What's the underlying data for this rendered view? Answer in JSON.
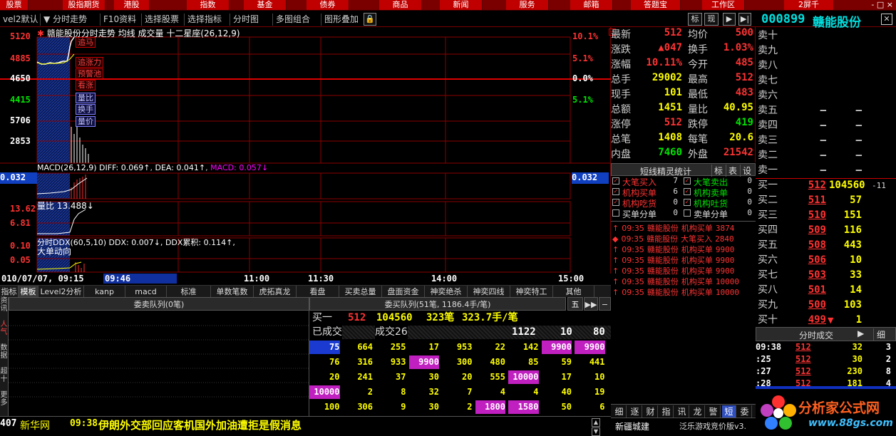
{
  "top_menu": [
    "股票",
    "股指期货",
    "港股",
    "指数",
    "基金",
    "债券",
    "商品",
    "新闻",
    "服务",
    "邮箱",
    "答题宝",
    "工作区",
    "2屏千"
  ],
  "window_controls": "- □ ×",
  "toolbar": {
    "items": [
      "vel2默认",
      "分时走势",
      "F10资料",
      "选择股票",
      "选择指标",
      "分时图",
      "多图组合",
      "图形叠加"
    ],
    "right_btns": [
      "标",
      "现",
      "▶",
      "▶|"
    ]
  },
  "chart": {
    "title": "赣能股份分时走势",
    "title_suffix": "均线  成交量  十二星座(26,12,9)",
    "price_labels": [
      "5120",
      "4885",
      "4650",
      "4415",
      "5706",
      "2853"
    ],
    "pct_labels": [
      "10.1%",
      "5.1%",
      "0.0%",
      "5.1%"
    ],
    "annotations": [
      "追马",
      "追涨力",
      "预警池",
      "看涨",
      "量比",
      "换手",
      "量价"
    ],
    "macd_title": "MACD(26,12,9)",
    "macd_diff": "DIFF: 0.069↑",
    "macd_dea": "DEA: 0.041↑",
    "macd_val": "MACD: 0.057↓",
    "macd_left": "0.032",
    "macd_right": "0.032",
    "vr_title": "量比 13.488↓",
    "vr_labels": [
      "13.62",
      "6.81"
    ],
    "ddx_title": "分时DDX(60,5,10)",
    "ddx_val": "DDX: 0.007↓,",
    "ddx_sum": "DDX累积: 0.114↑,",
    "ddx_sub": "大单动向",
    "ddx_labels": [
      "0.10",
      "0.05"
    ]
  },
  "time_axis": {
    "date": "010/07/07, 09:15",
    "cursor": "09:46",
    "ticks": [
      "11:00",
      "11:30",
      "14:00",
      "15:00"
    ]
  },
  "tabs": [
    "指标",
    "模板",
    "Level2分析",
    "kanp",
    "macd",
    "标准",
    "单数笔数",
    "虎拓真龙",
    "看盘",
    "买卖总量",
    "盘面资金",
    "神奕绝杀",
    "神奕四线",
    "神奕特工",
    "其他"
  ],
  "left_side_tabs": [
    "资讯",
    "人气",
    "数据",
    "超十",
    "更多"
  ],
  "commission_queue": {
    "title": "委卖队列(0笔)"
  },
  "buy_queue": {
    "title": "委买队列(51笔, 1186.4手/笔)",
    "btn": "五",
    "row1": [
      "买一",
      "512",
      "104560",
      "323笔",
      "323.7手/笔"
    ],
    "row2": [
      "已成交",
      "成交26",
      "1122",
      "10",
      "80"
    ],
    "grid": [
      [
        "75",
        "664",
        "255",
        "17",
        "953",
        "22",
        "142",
        "9900",
        "9900"
      ],
      [
        "76",
        "316",
        "933",
        "9900",
        "300",
        "480",
        "85",
        "59",
        "441"
      ],
      [
        "20",
        "241",
        "37",
        "30",
        "20",
        "555",
        "10000",
        "17",
        "10"
      ],
      [
        "10000",
        "2",
        "8",
        "32",
        "7",
        "4",
        "4",
        "40",
        "19"
      ],
      [
        "100",
        "306",
        "9",
        "30",
        "2",
        "1800",
        "1580",
        "50",
        "6"
      ]
    ]
  },
  "quote": {
    "code": "000899",
    "name": "赣能股份",
    "rows": [
      [
        "最新",
        "512",
        "均价",
        "500"
      ],
      [
        "涨跌",
        "▲047",
        "换手",
        "1.03%"
      ],
      [
        "涨幅",
        "10.11%",
        "今开",
        "485"
      ],
      [
        "总手",
        "29002",
        "最高",
        "512"
      ],
      [
        "现手",
        "101",
        "最低",
        "483"
      ],
      [
        "总额",
        "1451",
        "量比",
        "40.95"
      ],
      [
        "涨停",
        "512",
        "跌停",
        "419"
      ],
      [
        "总笔",
        "1408",
        "每笔",
        "20.6"
      ],
      [
        "内盘",
        "7460",
        "外盘",
        "21542"
      ]
    ]
  },
  "shortline": {
    "title": "短线精灵统计",
    "btns": [
      "标",
      "表",
      "设"
    ],
    "stats": [
      [
        "大笔买入",
        "7",
        "大笔卖出",
        "0"
      ],
      [
        "机构买单",
        "6",
        "机构卖单",
        "0"
      ],
      [
        "机构吃货",
        "0",
        "机构吐货",
        "0"
      ],
      [
        "买单分单",
        "0",
        "卖单分单",
        "0"
      ]
    ],
    "events": [
      [
        "09:35",
        "赣能股份",
        "机构买单",
        "3874"
      ],
      [
        "09:35",
        "赣能股份",
        "大笔买入",
        "2840"
      ],
      [
        "09:35",
        "赣能股份",
        "机构买单",
        "9900"
      ],
      [
        "09:35",
        "赣能股份",
        "机构买单",
        "9900"
      ],
      [
        "09:35",
        "赣能股份",
        "机构买单",
        "9900"
      ],
      [
        "09:35",
        "赣能股份",
        "机构买单",
        "10000"
      ],
      [
        "09:35",
        "赣能股份",
        "机构买单",
        "10000"
      ]
    ],
    "bottom_tabs": [
      "细",
      "逐",
      "财",
      "指",
      "讯",
      "龙",
      "警",
      "短",
      "委"
    ]
  },
  "book": {
    "sells": [
      "卖十",
      "卖九",
      "卖八",
      "卖七",
      "卖六",
      "卖五",
      "卖四",
      "卖三",
      "卖二",
      "卖一"
    ],
    "sell_dash": "—",
    "buys": [
      [
        "买一",
        "512",
        "104560",
        "-11"
      ],
      [
        "买二",
        "511",
        "57",
        ""
      ],
      [
        "买三",
        "510",
        "151",
        ""
      ],
      [
        "买四",
        "509",
        "116",
        ""
      ],
      [
        "买五",
        "508",
        "443",
        ""
      ],
      [
        "买六",
        "506",
        "10",
        ""
      ],
      [
        "买七",
        "503",
        "33",
        ""
      ],
      [
        "买八",
        "501",
        "14",
        ""
      ],
      [
        "买九",
        "500",
        "103",
        ""
      ],
      [
        "买十",
        "499",
        "1",
        ""
      ]
    ],
    "ticks_title": "分时成交",
    "ticks_btn": "细",
    "ticks": [
      [
        "09:38",
        "512",
        "32",
        "3"
      ],
      [
        ":25",
        "512",
        "30",
        "2"
      ],
      [
        ":27",
        "512",
        "230",
        "8"
      ],
      [
        ":28",
        "512",
        "181",
        "4"
      ]
    ]
  },
  "news": {
    "count": "407",
    "source": "新华网",
    "time": "09:38",
    "headline": "伊朗外交部回应客机国外加油遭拒是假消息"
  },
  "footer": {
    "left": "新疆城建",
    "right": "泛乐游戏竞价版v3.",
    "logo_text": "分析家公式网",
    "logo_url": "www.88gs.com"
  }
}
